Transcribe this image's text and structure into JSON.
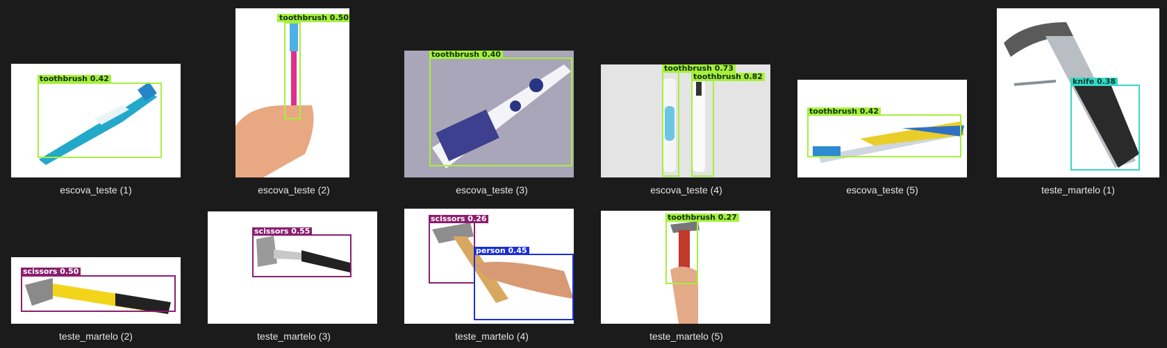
{
  "files": [
    {
      "caption": "escova_teste (1)",
      "detections": [
        {
          "label": "toothbrush 0.42"
        }
      ]
    },
    {
      "caption": "escova_teste (2)",
      "detections": [
        {
          "label": "toothbrush 0.50"
        }
      ]
    },
    {
      "caption": "escova_teste (3)",
      "detections": [
        {
          "label": "toothbrush 0.40"
        }
      ]
    },
    {
      "caption": "escova_teste (4)",
      "detections": [
        {
          "label": "toothbrush 0.73"
        },
        {
          "label": "toothbrush 0.82"
        }
      ]
    },
    {
      "caption": "escova_teste (5)",
      "detections": [
        {
          "label": "toothbrush 0.42"
        }
      ]
    },
    {
      "caption": "teste_martelo (1)",
      "detections": [
        {
          "label": "knife 0.38"
        }
      ]
    },
    {
      "caption": "teste_martelo (2)",
      "detections": [
        {
          "label": "scissors 0.50"
        }
      ]
    },
    {
      "caption": "teste_martelo (3)",
      "detections": [
        {
          "label": "scissors 0.55"
        }
      ]
    },
    {
      "caption": "teste_martelo (4)",
      "detections": [
        {
          "label": "scissors 0.26"
        },
        {
          "label": "person 0.45"
        }
      ]
    },
    {
      "caption": "teste_martelo (5)",
      "detections": [
        {
          "label": "toothbrush 0.27"
        }
      ]
    }
  ],
  "colors": {
    "toothbrush": "#a6f03c",
    "scissors": "#8a1e6e",
    "knife": "#36d8c4",
    "person": "#1b2fd4",
    "background": "#1b1b1b"
  }
}
